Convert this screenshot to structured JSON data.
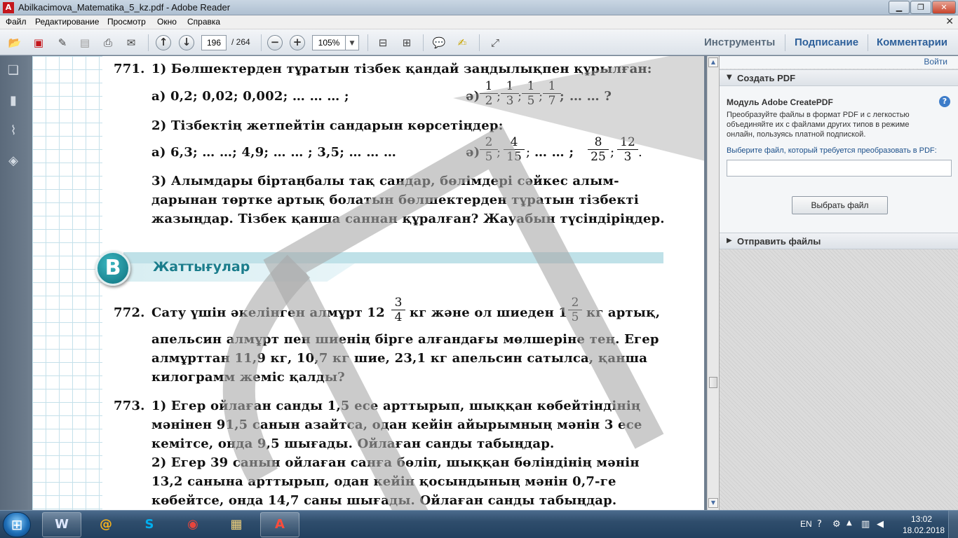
{
  "window": {
    "title": "Abilkacimova_Matematika_5_kz.pdf - Adobe Reader",
    "app_icon": "adobe-reader-icon"
  },
  "menu": [
    "Файл",
    "Редактирование",
    "Просмотр",
    "Окно",
    "Справка"
  ],
  "toolbar": {
    "page_current": "196",
    "page_total": "/ 264",
    "zoom": "105%",
    "links": {
      "tools": "Инструменты",
      "sign": "Подписание",
      "comments": "Комментарии"
    }
  },
  "document": {
    "p771": {
      "num": "771.",
      "q1": "1) Бөлшектерден тұратын тізбек қандай заңдылықпен құрылған:",
      "a1": "а) 0,2; 0,02; 0,002; … … … ;",
      "b1_prefix": "ә)",
      "b1_fracs": [
        [
          "1",
          "2"
        ],
        [
          "1",
          "3"
        ],
        [
          "1",
          "5"
        ],
        [
          "1",
          "7"
        ]
      ],
      "b1_suffix": "… … ?",
      "q2": "2) Тізбектің жетпейтін сандарын көрсетіңдер:",
      "a2": "а) 6,3; … …; 4,9; … … ; 3,5; … … …",
      "b2_prefix": "ә)",
      "b2_fracs": [
        [
          "2",
          "5"
        ],
        [
          "4",
          "15"
        ],
        [
          "8",
          "25"
        ],
        [
          "12",
          "3"
        ]
      ],
      "b2_mid": "… … ;",
      "q3_lines": [
        "3) Алымдары біртаңбалы тақ сандар, бөлімдері сәйкес алым-",
        "дарынан төртке артық болатын бөлшектерден тұратын тізбекті",
        "жазыңдар. Тізбек қанша саннан құралған? Жауабын түсіндіріңдер."
      ]
    },
    "section": {
      "badge": "B",
      "title": "Жаттығулар"
    },
    "p772": {
      "num": "772.",
      "line1_a": "Сату үшін әкелінген алмұрт 12",
      "frac1": [
        "3",
        "4"
      ],
      "line1_b": "кг және ол шиеден 1",
      "frac2": [
        "2",
        "5"
      ],
      "line1_c": "кг артық,",
      "lines": [
        "апельсин алмұрт пен шиенің бірге алғандағы мөлшеріне тең. Егер",
        "алмұрттан 11,9 кг, 10,7 кг шие, 23,1 кг апельсин сатылса, қанша",
        "килограмм жеміс қалды?"
      ]
    },
    "p773": {
      "num": "773.",
      "lines": [
        "1) Егер ойлаған санды 1,5 есе арттырып, шыққан көбейтіндінің",
        "мәнінен 91,5 санын азайтса, одан кейін айырымның мәнін 3 есе",
        "кемітсе, онда 9,5 шығады. Ойлаған санды табыңдар.",
        "2) Егер 39 санын ойлаған санға бөліп, шыққан бөліндінің мәнін",
        "13,2 санына арттырып, одан кейін қосындының мәнін 0,7-ге",
        "көбейтсе, онда 14,7 саны шығады. Ойлаған санды табыңдар."
      ]
    }
  },
  "right_panel": {
    "login": "Войти",
    "create_pdf": "Создать PDF",
    "module_title": "Модуль Adobe CreatePDF",
    "description": "Преобразуйте файлы в формат PDF и с легкостью объединяйте их с файлами других типов в режиме онлайн, пользуясь платной подпиской.",
    "choose_label": "Выберите файл, который требуется преобразовать в PDF:",
    "choose_button": "Выбрать файл",
    "send_files": "Отправить файлы"
  },
  "taskbar": {
    "lang": "EN",
    "time": "13:02",
    "date": "18.02.2018"
  }
}
